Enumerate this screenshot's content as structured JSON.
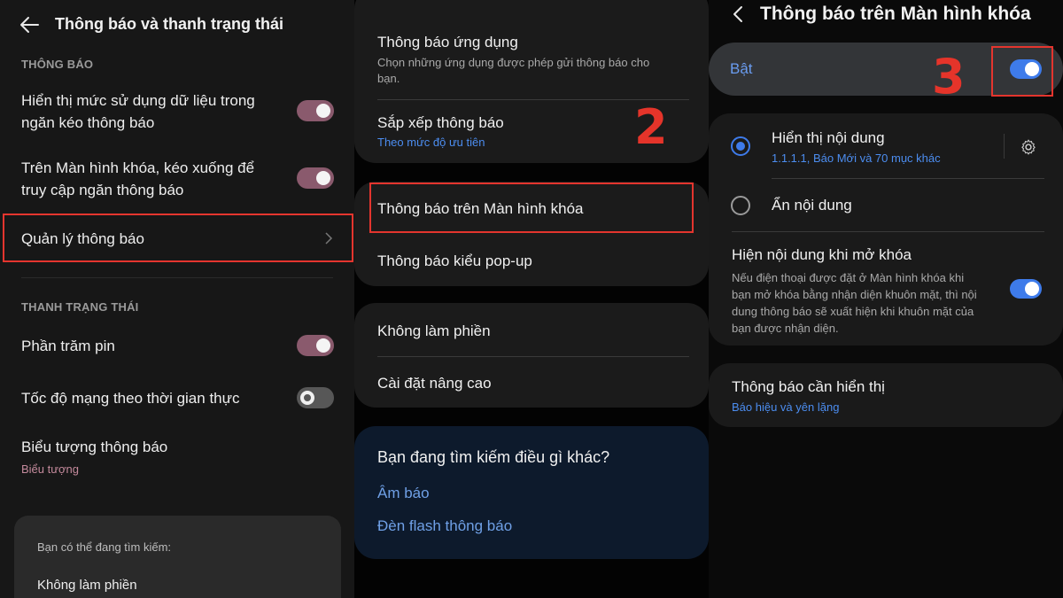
{
  "panel1": {
    "title": "Thông báo và thanh trạng thái",
    "section_notifications": "THÔNG BÁO",
    "data_usage_line1": "Hiển thị mức sử dụng dữ liệu trong",
    "data_usage_line2": "ngăn kéo thông báo",
    "data_usage_on": true,
    "lockscreen_line1": "Trên Màn hình khóa, kéo xuống để",
    "lockscreen_line2": "truy cập ngăn thông báo",
    "lockscreen_on": true,
    "manage": "Quản lý thông báo",
    "section_status_bar": "THANH TRẠNG THÁI",
    "battery_percent": "Phần trăm pin",
    "battery_percent_on": true,
    "network_speed": "Tốc độ mạng theo thời gian thực",
    "network_speed_on": false,
    "notif_icons": "Biểu tượng thông báo",
    "notif_icons_value": "Biểu tượng",
    "search_card_title": "Bạn có thể đang tìm kiếm:",
    "search_card_item": "Không làm phiền"
  },
  "panel2": {
    "app_notifications": "Thông báo ứng dụng",
    "app_notifications_desc_line1": "Chọn những ứng dụng được phép gửi thông báo cho",
    "app_notifications_desc_line2": "bạn.",
    "sort_notifications": "Sắp xếp thông báo",
    "sort_value": "Theo mức độ ưu tiên",
    "lockscreen_notifications": "Thông báo trên Màn hình khóa",
    "popup_notifications": "Thông báo kiểu pop-up",
    "do_not_disturb": "Không làm phiền",
    "advanced_settings": "Cài đặt nâng cao",
    "looking_for": "Bạn đang tìm kiếm điều gì khác?",
    "link_sound": "Âm báo",
    "link_flash": "Đèn flash thông báo",
    "step_label": "2"
  },
  "panel3": {
    "title": "Thông báo trên Màn hình khóa",
    "on_label": "Bật",
    "on": true,
    "step_label": "3",
    "show_content": "Hiển thị nội dung",
    "show_content_value": "1.1.1.1, Báo Mới và 70 mục khác",
    "hide_content": "Ẩn nội dung",
    "show_on_unlock": "Hiện nội dung khi mở khóa",
    "show_on_unlock_desc_line1": "Nếu điện thoại được đặt ở Màn hình khóa khi",
    "show_on_unlock_desc_line2": "bạn mở khóa bằng nhận diện khuôn mặt, thì nội",
    "show_on_unlock_desc_line3": "dung thông báo sẽ xuất hiện khi khuôn mặt của",
    "show_on_unlock_desc_line4": "bạn được nhận diện.",
    "show_on_unlock_on": true,
    "notifs_to_show": "Thông báo cần hiển thị",
    "notifs_to_show_value": "Báo hiệu và yên lặng"
  },
  "colors": {
    "highlight_red": "#e4352e",
    "accent_blue": "#3e7bea",
    "toggle_pink": "#8a5a6d"
  }
}
